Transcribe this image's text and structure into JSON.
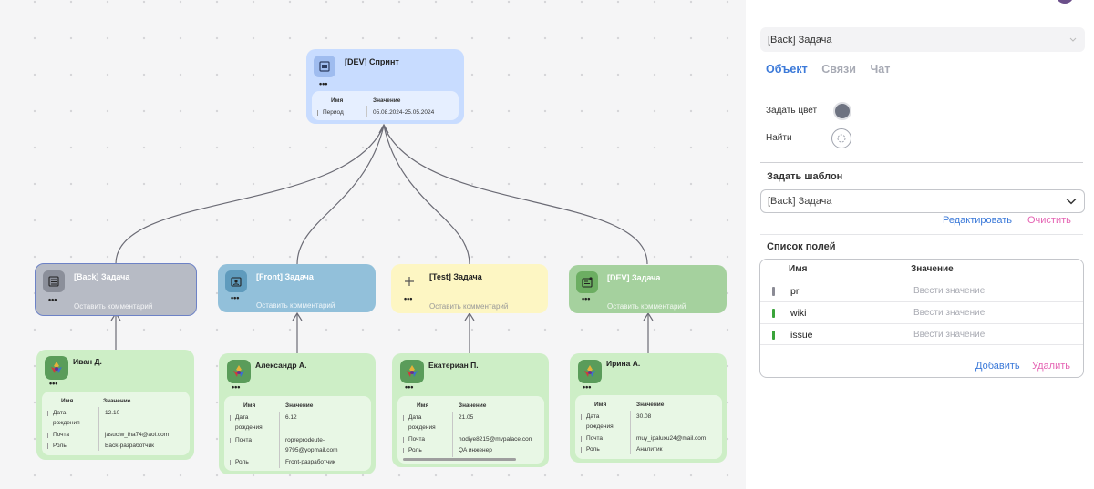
{
  "colors": {
    "sprint": "#c8dcff",
    "back": "#b7bbc5",
    "front": "#92c0da",
    "test": "#fdf6c3",
    "dev": "#a5d19e",
    "person": "#cdeec6",
    "accent": "#3c7ad9",
    "pink": "#e563b3",
    "green_mark": "#3aa43a",
    "grey_mark": "#8b8b95"
  },
  "sprint": {
    "title": "[DEV] Спринт",
    "dots": "•••",
    "col_name": "Имя",
    "col_value": "Значение",
    "rows": [
      {
        "k": "Период",
        "v": "05.08.2024-25.05.2024"
      }
    ]
  },
  "tasks": [
    {
      "title": "[Back] Задача",
      "dots": "•••",
      "comment": "Оставить комментарий",
      "icon": "list-icon"
    },
    {
      "title": "[Front] Задача",
      "dots": "•••",
      "comment": "Оставить комментарий",
      "icon": "id-card-icon"
    },
    {
      "title": "[Test] Задача",
      "dots": "•••",
      "comment": "Оставить комментарий",
      "icon": "plus-icon"
    },
    {
      "title": "[DEV] Задача",
      "dots": "•••",
      "comment": "Оставить комментарий",
      "icon": "board-icon"
    }
  ],
  "people": [
    {
      "name": "Иван Д.",
      "dots": "•••",
      "col_name": "Имя",
      "col_value": "Значение",
      "rows": [
        {
          "k": "Дата рождения",
          "v": "12.10"
        },
        {
          "k": "Почта",
          "v": "jasuciw_iha74@aol.com"
        },
        {
          "k": "Роль",
          "v": "Back-разработчик"
        }
      ]
    },
    {
      "name": "Александр А.",
      "dots": "•••",
      "col_name": "Имя",
      "col_value": "Значение",
      "rows": [
        {
          "k": "Дата рождения",
          "v": "6.12"
        },
        {
          "k": "Почта",
          "v": "ropreprodeute-9795@yopmail.com"
        },
        {
          "k": "Роль",
          "v": "Front-разработчик"
        }
      ]
    },
    {
      "name": "Екатериан П.",
      "dots": "•••",
      "col_name": "Имя",
      "col_value": "Значение",
      "rows": [
        {
          "k": "Дата рождения",
          "v": "21.05"
        },
        {
          "k": "Почта",
          "v": "nodiye8215@mvpalace.con"
        },
        {
          "k": "Роль",
          "v": "QA инженер"
        }
      ]
    },
    {
      "name": "Ирина А.",
      "dots": "•••",
      "col_name": "Имя",
      "col_value": "Значение",
      "rows": [
        {
          "k": "Дата рождения",
          "v": "30.08"
        },
        {
          "k": "Почта",
          "v": "muy_ipaluxu24@mail.com"
        },
        {
          "k": "Роль",
          "v": "Аналитик"
        }
      ]
    }
  ],
  "panel": {
    "selected_node": "[Back] Задача",
    "tabs": [
      "Объект",
      "Связи",
      "Чат"
    ],
    "set_color_label": "Задать цвет",
    "find_label": "Найти",
    "template_title": "Задать шаблон",
    "template_value": "[Back] Задача",
    "edit_link": "Редактировать",
    "clear_link": "Очистить",
    "fields_title": "Список полей",
    "fields_col_name": "Имя",
    "fields_col_value": "Значение",
    "fields": [
      {
        "name": "pr",
        "placeholder": "Ввести значение",
        "mark": "grey"
      },
      {
        "name": "wiki",
        "placeholder": "Ввести значение",
        "mark": "green"
      },
      {
        "name": "issue",
        "placeholder": "Ввести значение",
        "mark": "green"
      }
    ],
    "add_link": "Добавить",
    "delete_link": "Удалить"
  }
}
